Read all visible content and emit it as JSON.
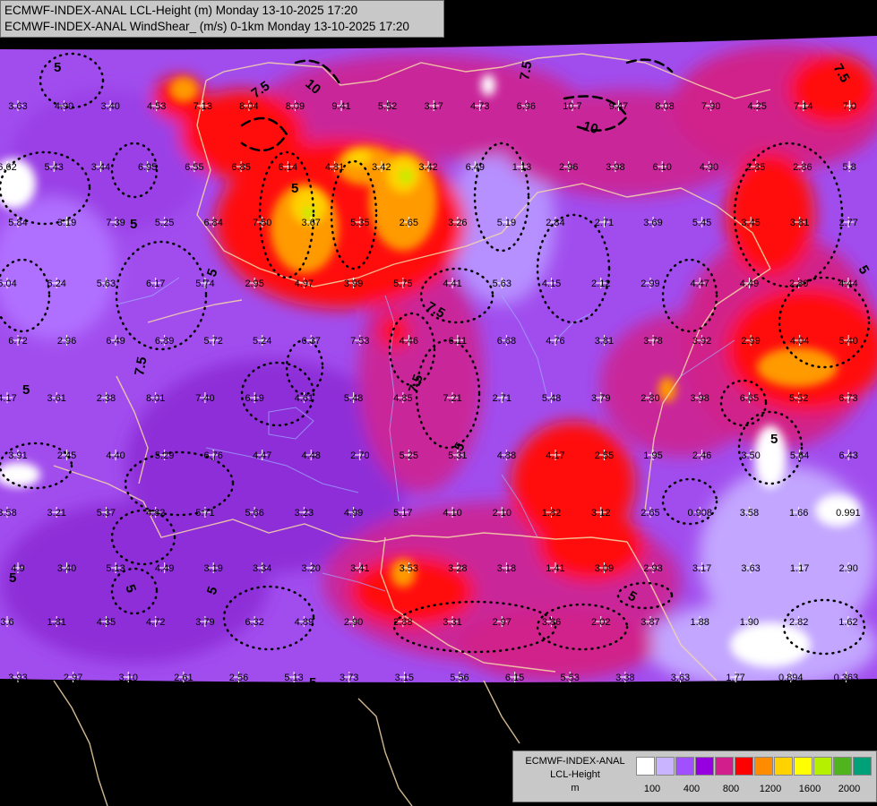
{
  "header": {
    "line1": "ECMWF-INDEX-ANAL LCL-Height (m) Monday 13-10-2025 17:20",
    "line2": "ECMWF-INDEX-ANAL WindShear_ (m/s) 0-1km Monday 13-10-2025 17:20"
  },
  "legend": {
    "title_lines": [
      "ECMWF-INDEX-ANAL",
      "LCL-Height",
      "m"
    ],
    "colors": [
      "#ffffff",
      "#c8b4ff",
      "#a050ff",
      "#9600e0",
      "#d21e8c",
      "#ff0000",
      "#ff8c00",
      "#ffd200",
      "#ffff00",
      "#b4f000",
      "#50b41e",
      "#00a078",
      "#0096ff"
    ],
    "tick_labels": [
      "100",
      "400",
      "800",
      "1200",
      "1600",
      "2000"
    ]
  },
  "contour_labels": [
    "5",
    "7.5",
    "10"
  ],
  "station_values": [
    "3.63",
    "4.90",
    "3.40",
    "4.53",
    "7.13",
    "8.04",
    "8.09",
    "9.41",
    "5.52",
    "3.17",
    "4.73",
    "6.96",
    "10.7",
    "9.47",
    "8.08",
    "7.90",
    "4.25",
    "7.14",
    "7.0",
    "6.62",
    "5.43",
    "3.44",
    "6.95",
    "6.55",
    "6.85",
    "6.14",
    "4.81",
    "3.42",
    "3.42",
    "6.49",
    "1.13",
    "2.96",
    "3.98",
    "6.10",
    "4.90",
    "2.85",
    "2.86",
    "5.8",
    "5.84",
    "3.19",
    "7.39",
    "5.25",
    "6.84",
    "7.50",
    "3.67",
    "5.35",
    "2.65",
    "3.26",
    "5.19",
    "2.84",
    "2.71",
    "3.69",
    "5.45",
    "3.45",
    "3.81",
    "2.77",
    "5.04",
    "6.24",
    "5.63",
    "6.17",
    "5.74",
    "2.95",
    "4.97",
    "3.99",
    "5.75",
    "4.41",
    "5.63",
    "4.15",
    "2.12",
    "2.99",
    "4.47",
    "4.49",
    "2.80",
    "4.44",
    "6.72",
    "2.96",
    "6.49",
    "6.89",
    "5.72",
    "5.24",
    "6.37",
    "7.53",
    "4.46",
    "6.11",
    "6.68",
    "4.76",
    "3.81",
    "3.78",
    "3.92",
    "2.99",
    "4.04",
    "5.40",
    "4.17",
    "3.61",
    "2.38",
    "8.01",
    "7.40",
    "6.19",
    "4.61",
    "5.48",
    "4.85",
    "7.21",
    "2.71",
    "5.48",
    "3.79",
    "2.80",
    "3.98",
    "6.65",
    "5.52",
    "6.73",
    "3.91",
    "2.45",
    "4.40",
    "5.29",
    "6.76",
    "4.47",
    "4.48",
    "2.70",
    "5.25",
    "5.31",
    "4.88",
    "4.17",
    "2.55",
    "1.95",
    "2.46",
    "3.50",
    "5.64",
    "6.43",
    "3.58",
    "3.21",
    "5.37",
    "4.82",
    "5.71",
    "5.66",
    "3.23",
    "4.99",
    "5.17",
    "4.10",
    "2.10",
    "1.82",
    "3.12",
    "2.65",
    "0.908",
    "3.58",
    "1.66",
    "0.991",
    "4.9",
    "3.40",
    "5.13",
    "4.49",
    "3.19",
    "3.34",
    "3.20",
    "3.41",
    "3.53",
    "3.28",
    "3.18",
    "1.41",
    "3.09",
    "2.93",
    "3.17",
    "3.63",
    "1.17",
    "2.90",
    "3.6",
    "1.81",
    "4.35",
    "4.72",
    "3.79",
    "6.32",
    "4.89",
    "2.90",
    "2.88",
    "3.31",
    "2.97",
    "3.86",
    "2.02",
    "3.87",
    "1.88",
    "1.90",
    "2.82",
    "1.62",
    "3.93",
    "2.97",
    "3.10",
    "2.61",
    "2.56",
    "5.13",
    "3.73",
    "3.15",
    "5.56",
    "6.15",
    "5.53",
    "3.38",
    "3.63",
    "1.77",
    "0.894",
    "0.363"
  ]
}
